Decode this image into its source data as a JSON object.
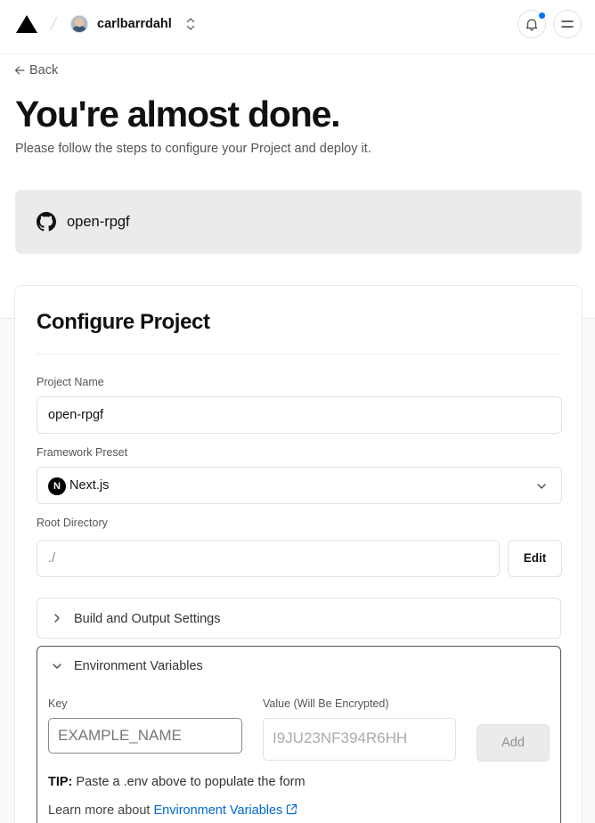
{
  "header": {
    "username": "carlbarrdahl",
    "icons": [
      "vercel-logo-icon",
      "slash-separator-icon",
      "avatar",
      "chevron-up-down-icon",
      "bell-icon",
      "menu-icon"
    ],
    "notification_dot_color": "#0070f3"
  },
  "page": {
    "back_label": "Back",
    "title": "You're almost done.",
    "subtitle": "Please follow the steps to configure your Project and deploy it."
  },
  "repo": {
    "name": "open-rpgf",
    "icon": "github-icon"
  },
  "configure": {
    "title": "Configure Project",
    "project_name_label": "Project Name",
    "project_name_value": "open-rpgf",
    "framework_label": "Framework Preset",
    "framework_value": "Next.js",
    "framework_icon_letter": "N",
    "root_dir_label": "Root Directory",
    "root_dir_value": "./",
    "edit_label": "Edit",
    "build_section_label": "Build and Output Settings",
    "env_section_label": "Environment Variables",
    "env": {
      "key_label": "Key",
      "key_placeholder": "EXAMPLE_NAME",
      "value_label": "Value (Will Be Encrypted)",
      "value_placeholder": "I9JU23NF394R6HH",
      "add_label": "Add",
      "tip_bold": "TIP:",
      "tip_text": "Paste a .env above to populate the form",
      "learn_prefix": "Learn more about",
      "learn_link": "Environment Variables"
    }
  },
  "colors": {
    "link": "#0068d6",
    "accent_blue": "#0070f3",
    "repo_bg": "#ebebeb"
  }
}
